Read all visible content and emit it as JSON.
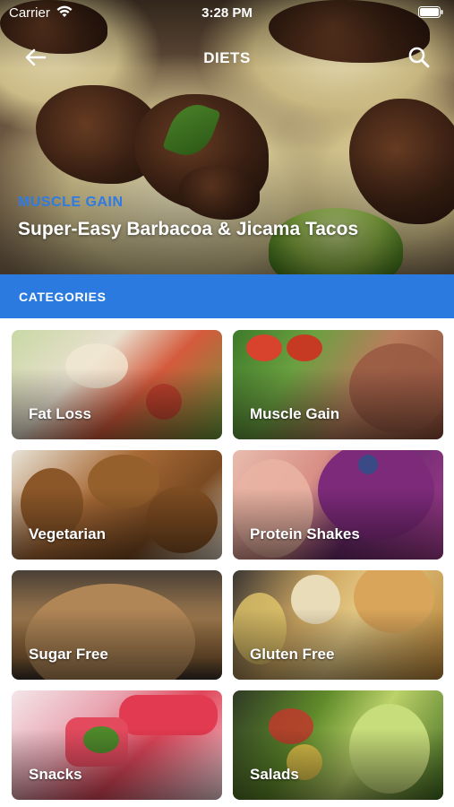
{
  "status_bar": {
    "carrier": "Carrier",
    "time": "3:28 PM"
  },
  "nav": {
    "title": "DIETS"
  },
  "hero": {
    "tag": "MUSCLE GAIN",
    "title": "Super-Easy Barbacoa & Jicama Tacos"
  },
  "categories_header": "CATEGORIES",
  "categories": [
    {
      "label": "Fat Loss"
    },
    {
      "label": "Muscle Gain"
    },
    {
      "label": "Vegetarian"
    },
    {
      "label": "Protein Shakes"
    },
    {
      "label": "Sugar Free"
    },
    {
      "label": "Gluten Free"
    },
    {
      "label": "Snacks"
    },
    {
      "label": "Salads"
    }
  ],
  "colors": {
    "accent": "#2b7ae0",
    "tag": "#2e7be4"
  }
}
